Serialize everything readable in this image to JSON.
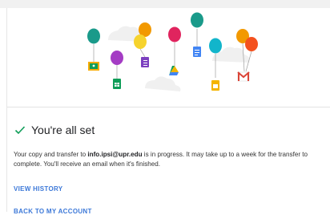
{
  "status": {
    "title": "You're all set",
    "body_prefix": "Your copy and transfer to ",
    "email": "info.ipsi@upr.edu",
    "body_suffix": " is in progress. It may take up to a week for the transfer to complete. You'll receive an email when it's finished."
  },
  "links": {
    "view_history": "VIEW HISTORY",
    "back_to_account": "BACK TO MY ACCOUNT"
  },
  "illustration": {
    "icons": [
      "classroom-icon",
      "sheets-icon",
      "forms-icon",
      "drive-icon",
      "docs-icon",
      "slides-icon",
      "gmail-icon"
    ]
  },
  "colors": {
    "check": "#0f9d58",
    "link": "#3c78d8",
    "balloon_teal": "#1a9a8a",
    "balloon_purple": "#a43cc4",
    "balloon_orange": "#f29900",
    "balloon_yellow": "#f6d32d",
    "balloon_pink": "#e0245e",
    "balloon_cyan": "#12b5cb",
    "balloon_red": "#f4511e"
  }
}
